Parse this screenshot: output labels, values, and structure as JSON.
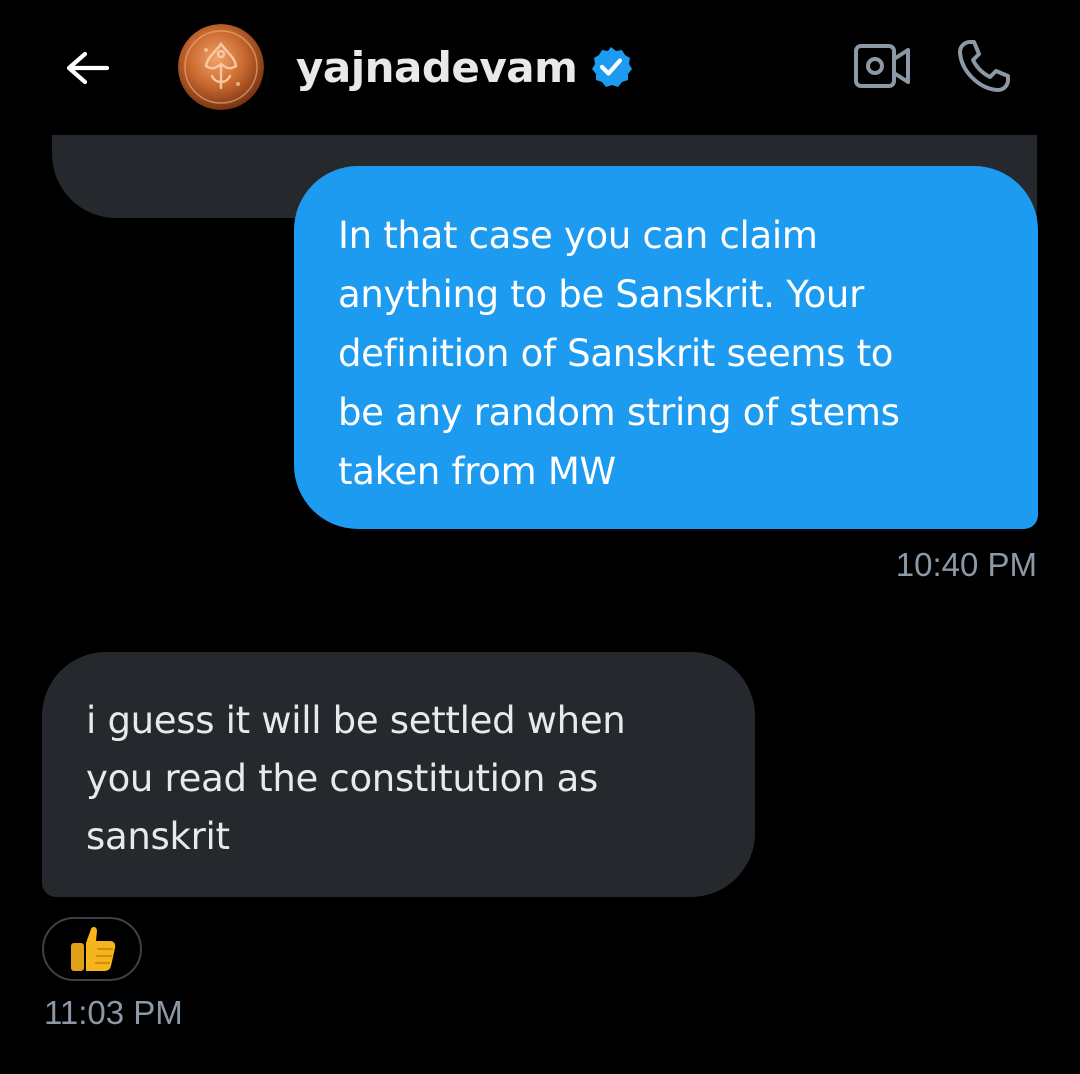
{
  "header": {
    "title": "yajnadevam",
    "verified": true,
    "back_icon": "arrow-left-icon",
    "video_icon": "video-camera-icon",
    "call_icon": "phone-icon",
    "accent_color": "#1d9bf0"
  },
  "messages": [
    {
      "direction": "sent",
      "text": "In that case you can claim\nanything to be Sanskrit. Your\ndefinition of Sanskrit seems to\nbe any random string of stems\ntaken from MW",
      "time": "10:40 PM",
      "bubble_color": "#1d9bf0"
    },
    {
      "direction": "received",
      "text": "i guess it will be settled when\nyou read the constitution as\nsanskrit",
      "time": "11:03 PM",
      "bubble_color": "#25292e",
      "reaction": "👍"
    }
  ]
}
